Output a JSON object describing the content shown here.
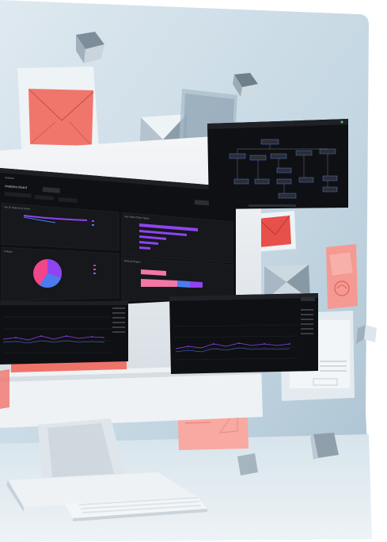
{
  "colors": {
    "backdrop": "#c9dbe6",
    "panel_dark": "#111215",
    "accent_red": "#f26d64",
    "accent_purple": "#8e44f0",
    "accent_pink": "#f277a6",
    "accent_blue": "#4a7cf0"
  },
  "dashboard": {
    "title": "Analytics Board",
    "filter_labels": [
      "",
      "",
      ""
    ],
    "panels": [
      {
        "title": "Top 10 Objects by Count"
      },
      {
        "title": "Top Failed Policy Types"
      },
      {
        "title": "Policies"
      },
      {
        "title": "Data by Region"
      }
    ]
  },
  "icons": [
    "envelope-icon",
    "document-icon",
    "cube-icon"
  ]
}
